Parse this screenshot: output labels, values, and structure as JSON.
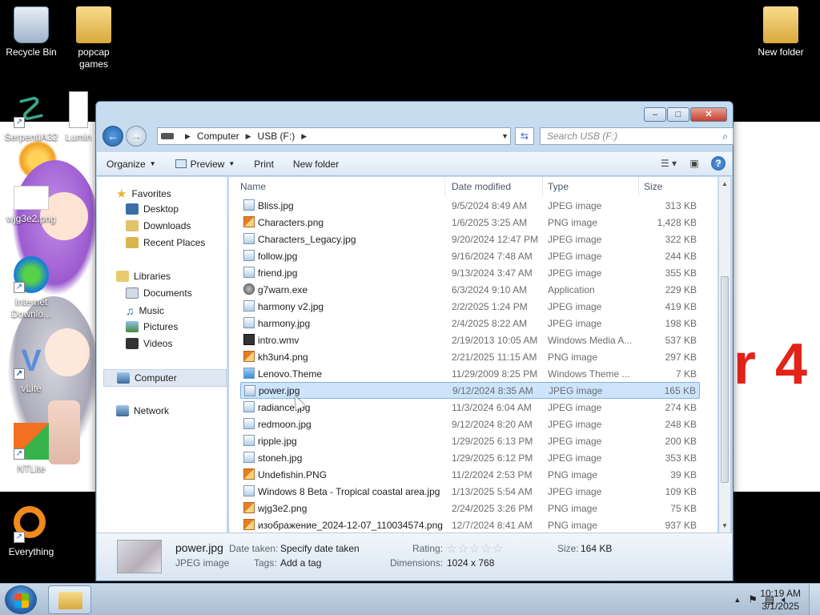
{
  "desktop": {
    "wallpaper_text": "r 4",
    "icons": [
      {
        "label": "Recycle Bin",
        "icon": "recycle-bin-icon"
      },
      {
        "label": "popcap games",
        "icon": "folder-icon"
      },
      {
        "label": "New folder",
        "icon": "folder-icon"
      },
      {
        "label": "SerpentIA32",
        "icon": "serpent-icon"
      },
      {
        "label": "Lumin",
        "icon": "document-icon"
      },
      {
        "label": "wjg3e2.png",
        "icon": "image-icon"
      },
      {
        "label": "Internet Downlo...",
        "icon": "internet-download-icon"
      },
      {
        "label": "vLite",
        "icon": "vlite-icon"
      },
      {
        "label": "NTLite",
        "icon": "ntlite-icon"
      },
      {
        "label": "Everything",
        "icon": "everything-icon"
      }
    ]
  },
  "explorer": {
    "caption": {
      "minimize": "–",
      "maximize": "□",
      "close": "✕"
    },
    "address": {
      "parts": [
        "Computer",
        "USB (F:)"
      ]
    },
    "search": {
      "placeholder": "Search USB (F:)"
    },
    "toolbar": {
      "organize": "Organize",
      "preview": "Preview",
      "print": "Print",
      "new_folder": "New folder"
    },
    "nav": {
      "favorites": "Favorites",
      "desktop": "Desktop",
      "downloads": "Downloads",
      "recent": "Recent Places",
      "libraries": "Libraries",
      "documents": "Documents",
      "music": "Music",
      "pictures": "Pictures",
      "videos": "Videos",
      "computer": "Computer",
      "network": "Network"
    },
    "columns": {
      "name": "Name",
      "date": "Date modified",
      "type": "Type",
      "size": "Size"
    },
    "files": [
      {
        "name": "Bliss.jpg",
        "date": "9/5/2024 8:49 AM",
        "type": "JPEG image",
        "size": "313 KB",
        "kind": "jpg"
      },
      {
        "name": "Characters.png",
        "date": "1/6/2025 3:25 AM",
        "type": "PNG image",
        "size": "1,428 KB",
        "kind": "png"
      },
      {
        "name": "Characters_Legacy.jpg",
        "date": "9/20/2024 12:47 PM",
        "type": "JPEG image",
        "size": "322 KB",
        "kind": "jpg"
      },
      {
        "name": "follow.jpg",
        "date": "9/16/2024 7:48 AM",
        "type": "JPEG image",
        "size": "244 KB",
        "kind": "jpg"
      },
      {
        "name": "friend.jpg",
        "date": "9/13/2024 3:47 AM",
        "type": "JPEG image",
        "size": "355 KB",
        "kind": "jpg"
      },
      {
        "name": "g7warn.exe",
        "date": "6/3/2024 9:10 AM",
        "type": "Application",
        "size": "229 KB",
        "kind": "exe"
      },
      {
        "name": "harmony v2.jpg",
        "date": "2/2/2025 1:24 PM",
        "type": "JPEG image",
        "size": "419 KB",
        "kind": "jpg"
      },
      {
        "name": "harmony.jpg",
        "date": "2/4/2025 8:22 AM",
        "type": "JPEG image",
        "size": "198 KB",
        "kind": "jpg"
      },
      {
        "name": "intro.wmv",
        "date": "2/19/2013 10:05 AM",
        "type": "Windows Media A...",
        "size": "537 KB",
        "kind": "vid"
      },
      {
        "name": "kh3un4.png",
        "date": "2/21/2025 11:15 AM",
        "type": "PNG image",
        "size": "297 KB",
        "kind": "png"
      },
      {
        "name": "Lenovo.Theme",
        "date": "11/29/2009 8:25 PM",
        "type": "Windows Theme ...",
        "size": "7 KB",
        "kind": "theme"
      },
      {
        "name": "power.jpg",
        "date": "9/12/2024 8:35 AM",
        "type": "JPEG image",
        "size": "165 KB",
        "kind": "jpg",
        "selected": true
      },
      {
        "name": "radiance.jpg",
        "date": "11/3/2024 6:04 AM",
        "type": "JPEG image",
        "size": "274 KB",
        "kind": "jpg"
      },
      {
        "name": "redmoon.jpg",
        "date": "9/12/2024 8:20 AM",
        "type": "JPEG image",
        "size": "248 KB",
        "kind": "jpg"
      },
      {
        "name": "ripple.jpg",
        "date": "1/29/2025 6:13 PM",
        "type": "JPEG image",
        "size": "200 KB",
        "kind": "jpg"
      },
      {
        "name": "stoneh.jpg",
        "date": "1/29/2025 6:12 PM",
        "type": "JPEG image",
        "size": "353 KB",
        "kind": "jpg"
      },
      {
        "name": "Undefishin.PNG",
        "date": "11/2/2024 2:53 PM",
        "type": "PNG image",
        "size": "39 KB",
        "kind": "png"
      },
      {
        "name": "Windows 8 Beta - Tropical coastal area.jpg",
        "date": "1/13/2025 5:54 AM",
        "type": "JPEG image",
        "size": "109 KB",
        "kind": "jpg"
      },
      {
        "name": "wjg3e2.png",
        "date": "2/24/2025 3:26 PM",
        "type": "PNG image",
        "size": "75 KB",
        "kind": "png"
      },
      {
        "name": "изображение_2024-12-07_110034574.png",
        "date": "12/7/2024 8:41 AM",
        "type": "PNG image",
        "size": "937 KB",
        "kind": "png"
      }
    ],
    "details": {
      "filename": "power.jpg",
      "filetype": "JPEG image",
      "date_taken_label": "Date taken:",
      "date_taken_value": "Specify date taken",
      "tags_label": "Tags:",
      "tags_value": "Add a tag",
      "rating_label": "Rating:",
      "rating_stars": 0,
      "dimensions_label": "Dimensions:",
      "dimensions_value": "1024 x 768",
      "size_label": "Size:",
      "size_value": "164 KB"
    }
  },
  "taskbar": {
    "time": "10:19 AM",
    "date": "3/1/2025",
    "tray_up": "▲"
  }
}
